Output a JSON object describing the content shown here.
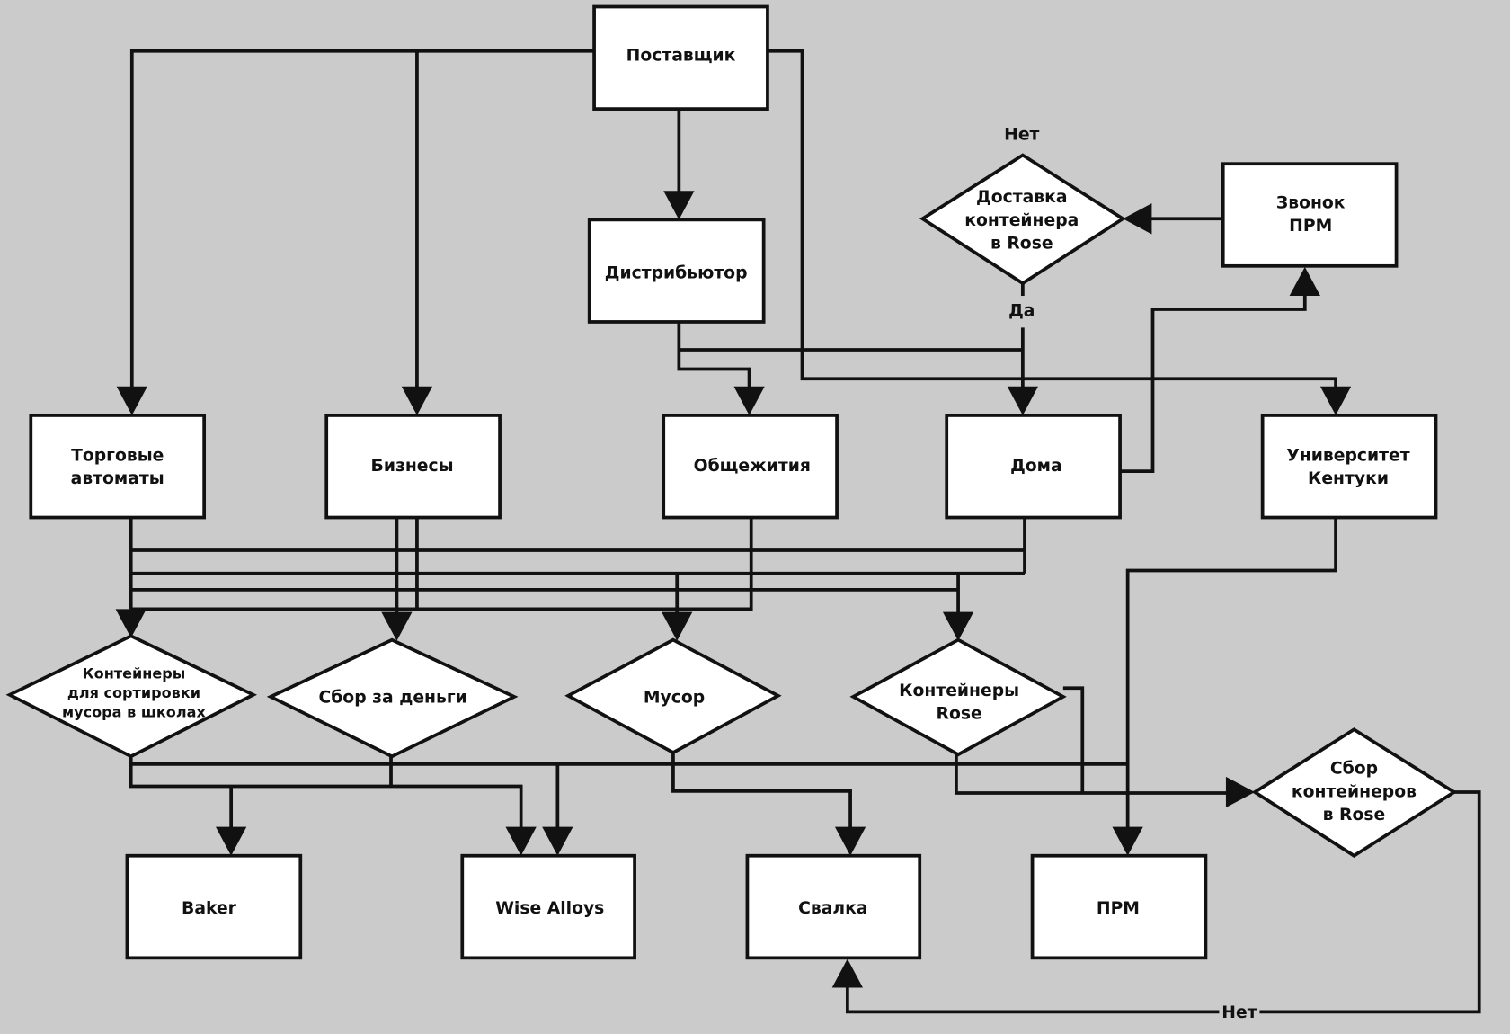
{
  "diagram": {
    "background": "#cbcbcb",
    "nodes": {
      "supplier": {
        "lines": [
          "Поставщик"
        ]
      },
      "distributor": {
        "lines": [
          "Дистрибьютор"
        ]
      },
      "container_delivery": {
        "lines": [
          "Доставка",
          "контейнера",
          "в Rose"
        ]
      },
      "call_prm": {
        "lines": [
          "Звонок",
          "ПРМ"
        ]
      },
      "vending": {
        "lines": [
          "Торговые",
          "автоматы"
        ]
      },
      "businesses": {
        "lines": [
          "Бизнесы"
        ]
      },
      "dorms": {
        "lines": [
          "Общежития"
        ]
      },
      "homes": {
        "lines": [
          "Дома"
        ]
      },
      "university": {
        "lines": [
          "Университет",
          "Кентуки"
        ]
      },
      "school_bins": {
        "lines": [
          "Контейнеры",
          "для сортировки",
          "мусора в школах"
        ]
      },
      "paid_pickup": {
        "lines": [
          "Сбор за деньги"
        ]
      },
      "trash": {
        "lines": [
          "Мусор"
        ]
      },
      "rose_bins": {
        "lines": [
          "Контейнеры",
          "Rose"
        ]
      },
      "rose_collection": {
        "lines": [
          "Сбор",
          "контейнеров",
          "в Rose"
        ]
      },
      "baker": {
        "lines": [
          "Baker"
        ]
      },
      "wise_alloys": {
        "lines": [
          "Wise Alloys"
        ]
      },
      "landfill": {
        "lines": [
          "Свалка"
        ]
      },
      "prm": {
        "lines": [
          "ПРМ"
        ]
      }
    },
    "edge_labels": {
      "delivery_no": "Нет",
      "delivery_yes": "Да",
      "collection_no": "Нет"
    }
  }
}
